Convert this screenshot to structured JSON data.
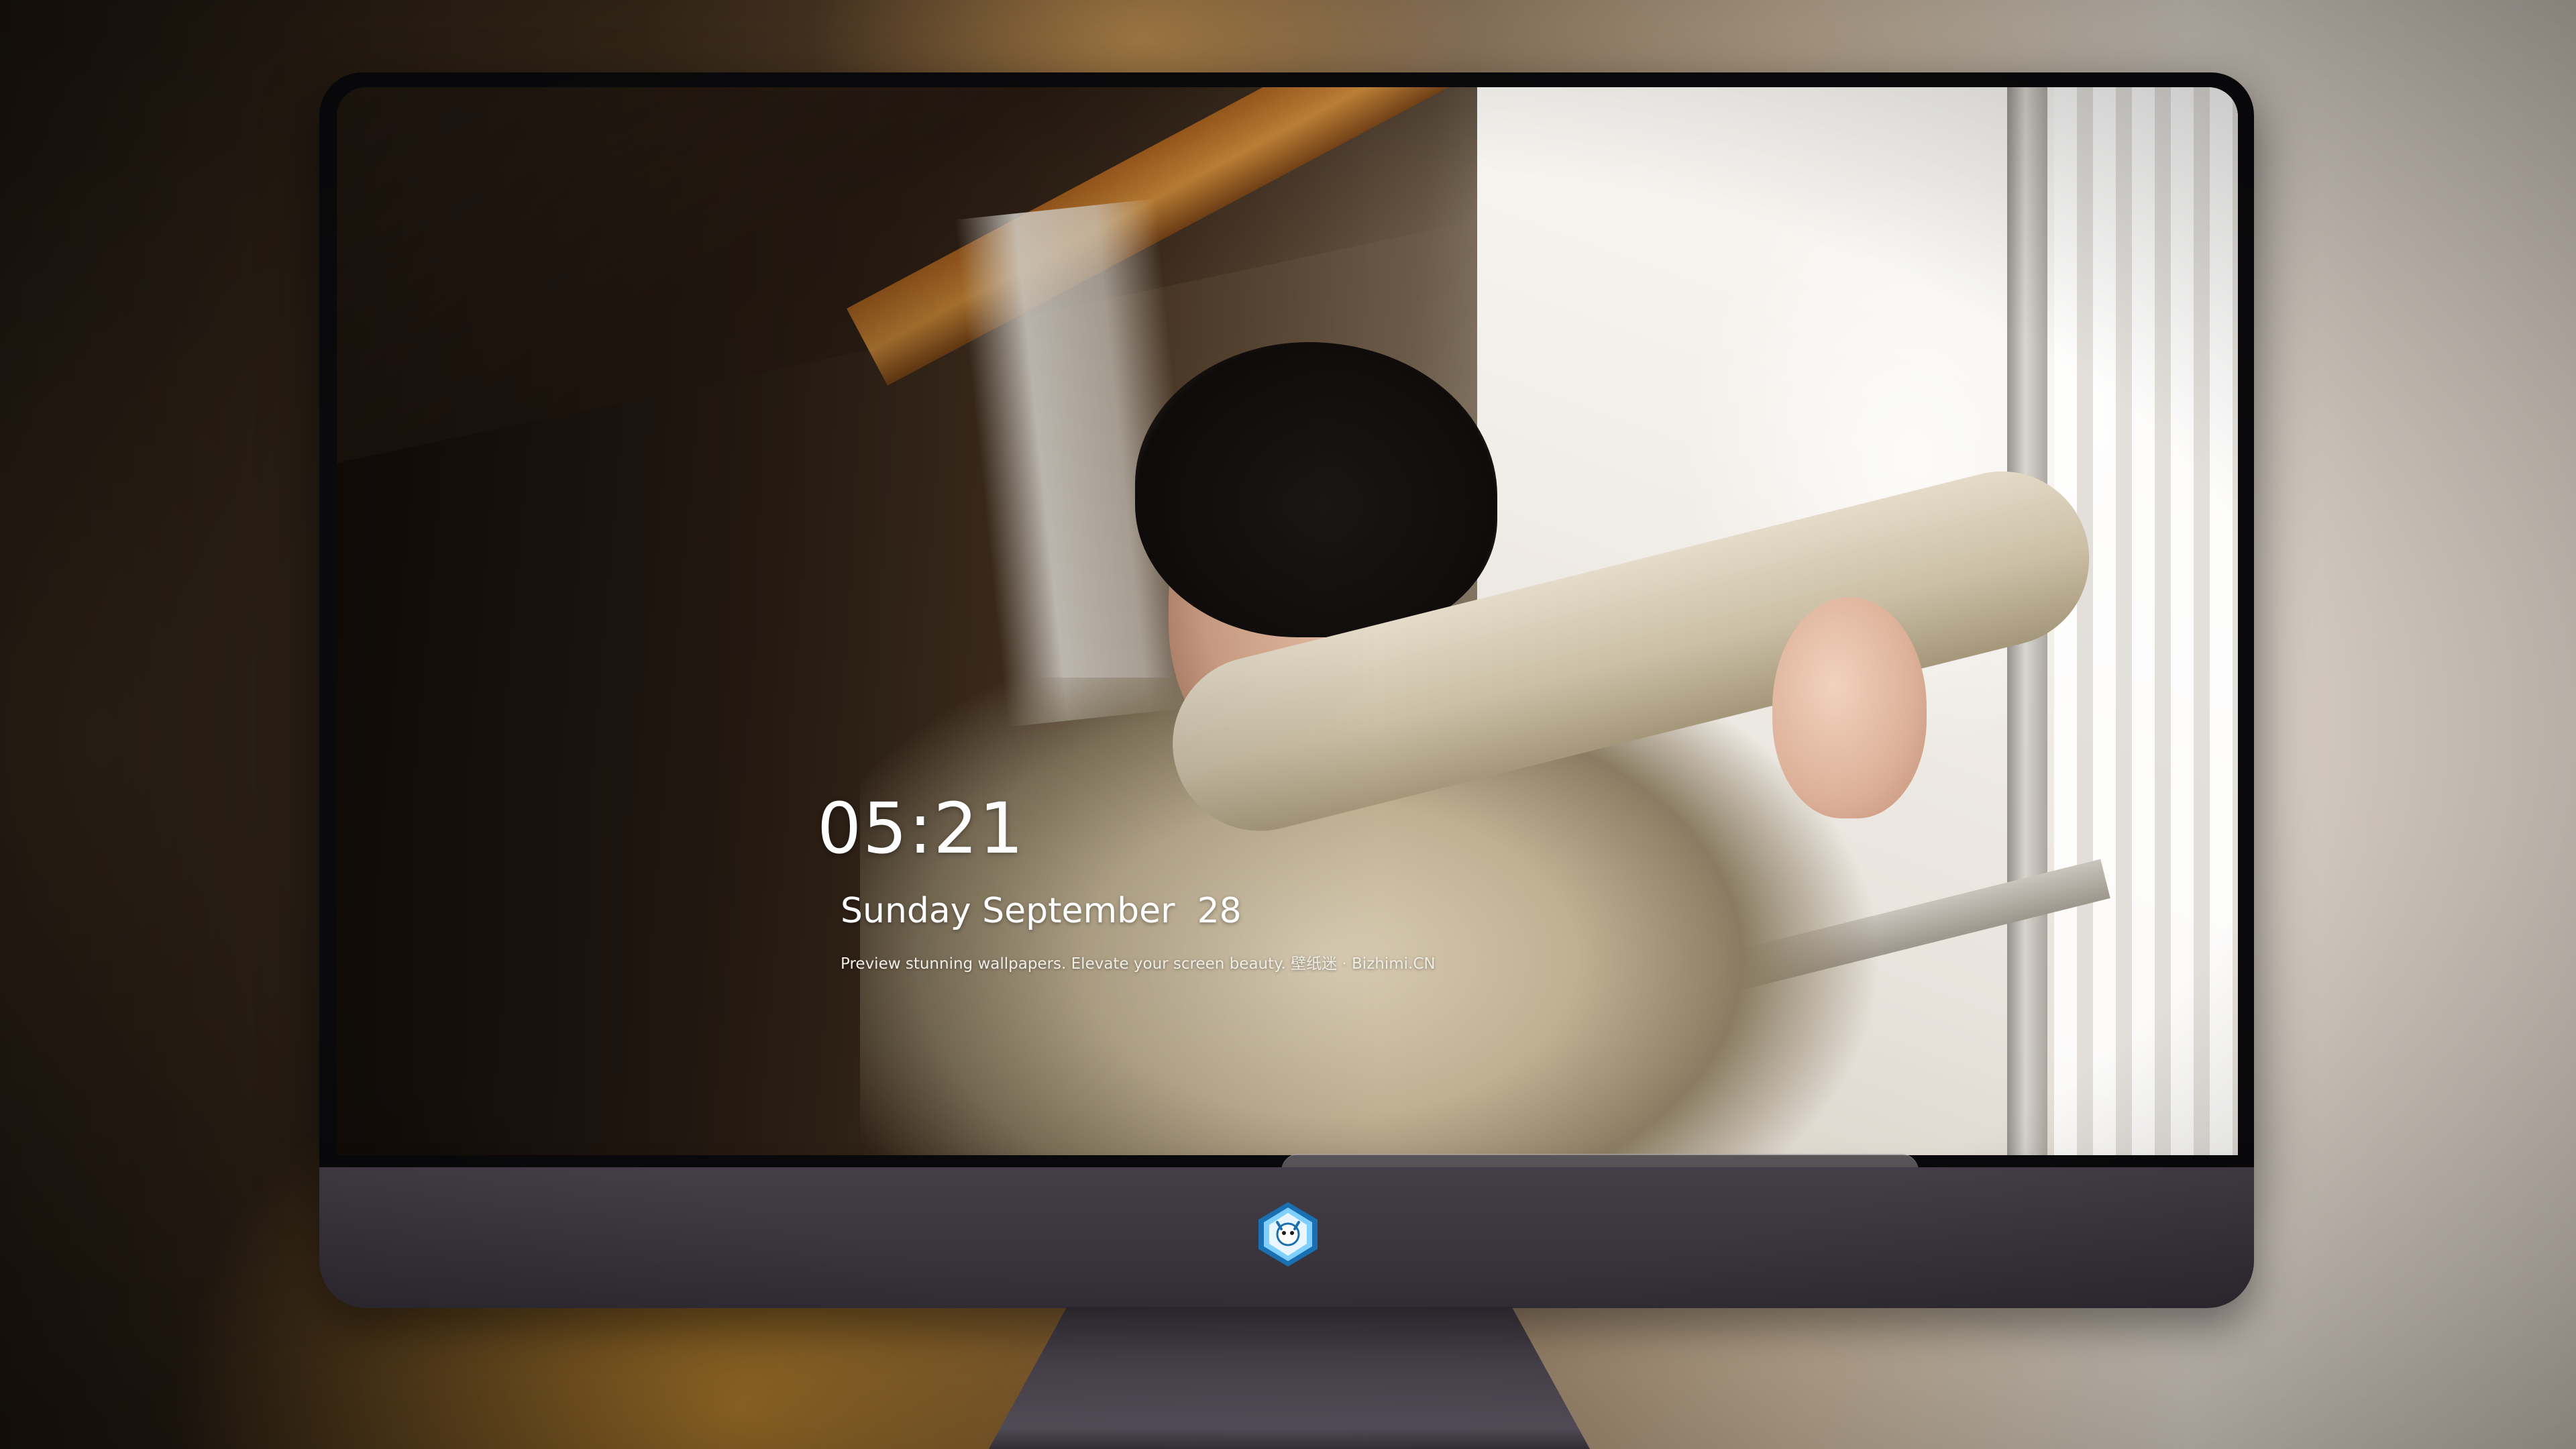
{
  "lock_screen": {
    "time": "05:21",
    "date": "Sunday September  28",
    "tagline": "Preview stunning wallpapers. Elevate your screen beauty. 壁纸迷 · Bizhimi.CN"
  },
  "dock": {
    "apps": [
      {
        "name": "messages-icon"
      },
      {
        "name": "weather-icon"
      },
      {
        "name": "clock-icon"
      },
      {
        "name": "preview-icon"
      },
      {
        "name": "clips-icon"
      },
      {
        "name": "notes-icon"
      },
      {
        "name": "photo-booth-icon"
      },
      {
        "name": "music-icon"
      },
      {
        "name": "app-store-icon"
      },
      {
        "name": "camera-icon"
      }
    ]
  },
  "monitor": {
    "logo": "dragon-mascot-logo-icon"
  }
}
